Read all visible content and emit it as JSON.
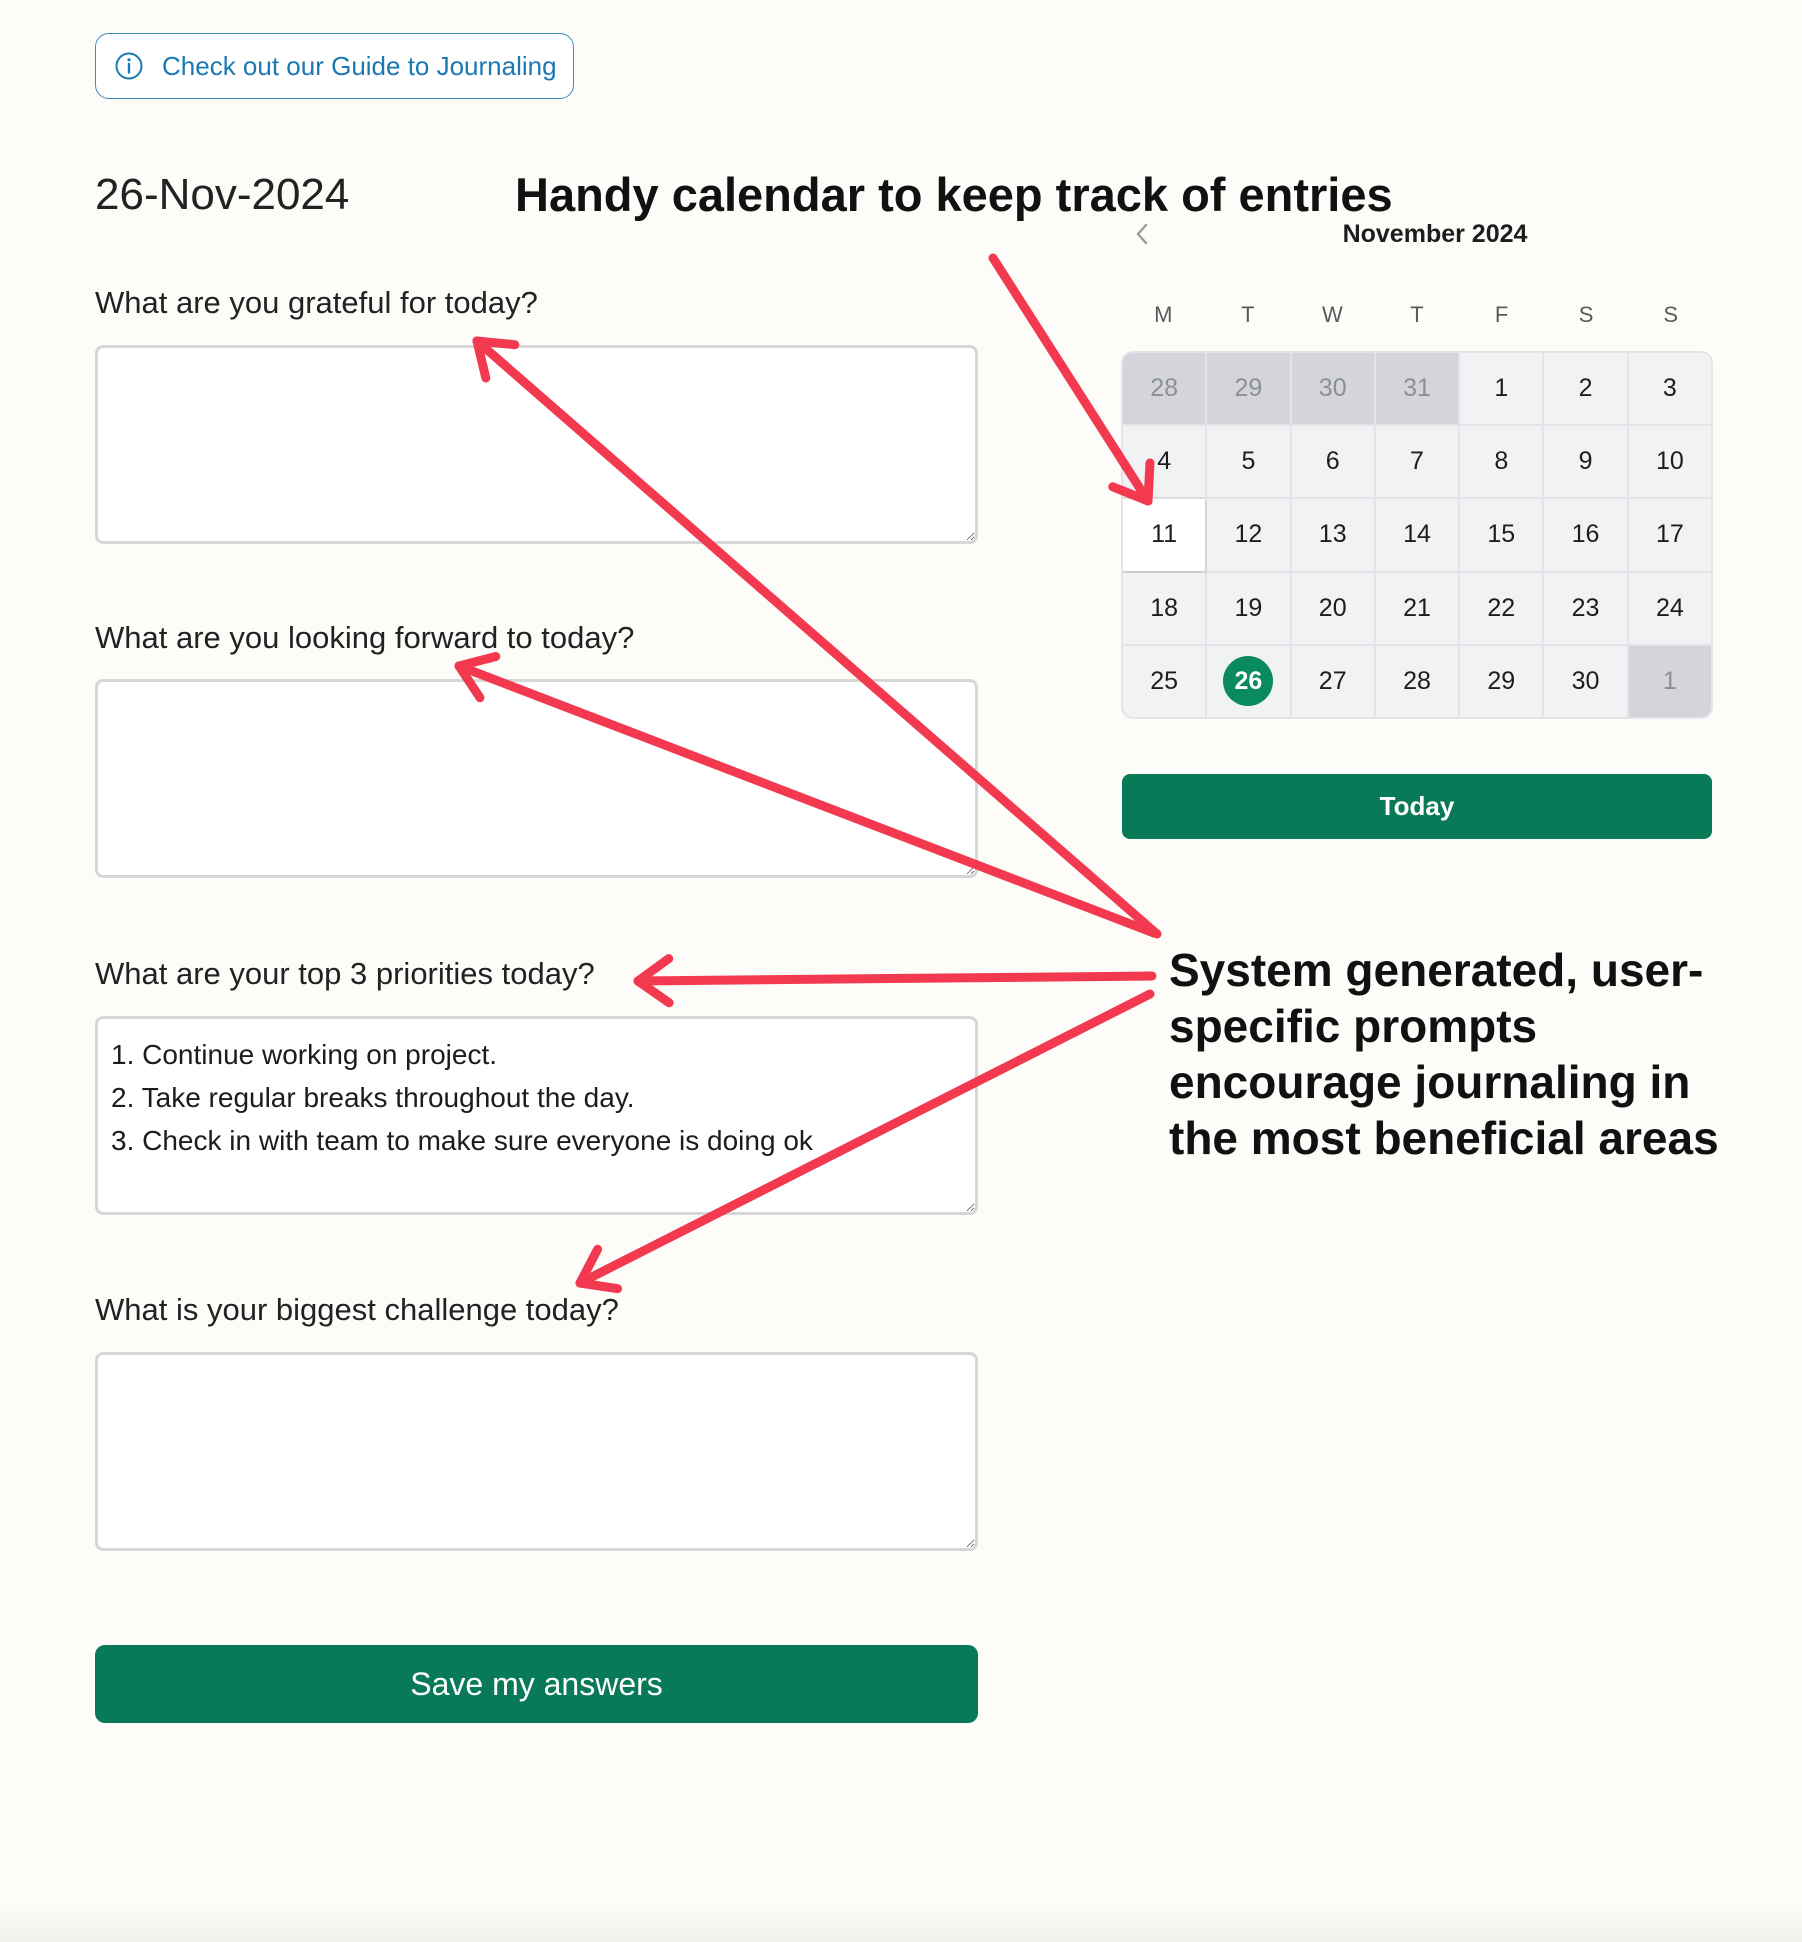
{
  "guide_link": {
    "label": "Check out our Guide to Journaling",
    "icon": "info-icon"
  },
  "journal": {
    "date": "26-Nov-2024",
    "questions": [
      {
        "label": "What are you grateful for today?",
        "answer": ""
      },
      {
        "label": "What are you looking forward to today?",
        "answer": ""
      },
      {
        "label": "What are your top 3 priorities today?",
        "answer": "1. Continue working on project.\n2. Take regular breaks throughout the day.\n3. Check in with team to make sure everyone is doing ok"
      },
      {
        "label": "What is your biggest challenge today?",
        "answer": ""
      }
    ],
    "save_label": "Save my answers"
  },
  "calendar": {
    "title": "November 2024",
    "weekdays": [
      "M",
      "T",
      "W",
      "T",
      "F",
      "S",
      "S"
    ],
    "days": [
      {
        "n": "28",
        "outside": true
      },
      {
        "n": "29",
        "outside": true
      },
      {
        "n": "30",
        "outside": true
      },
      {
        "n": "31",
        "outside": true
      },
      {
        "n": "1"
      },
      {
        "n": "2"
      },
      {
        "n": "3"
      },
      {
        "n": "4"
      },
      {
        "n": "5"
      },
      {
        "n": "6"
      },
      {
        "n": "7"
      },
      {
        "n": "8"
      },
      {
        "n": "9"
      },
      {
        "n": "10"
      },
      {
        "n": "11",
        "hover": true
      },
      {
        "n": "12"
      },
      {
        "n": "13"
      },
      {
        "n": "14"
      },
      {
        "n": "15"
      },
      {
        "n": "16"
      },
      {
        "n": "17"
      },
      {
        "n": "18"
      },
      {
        "n": "19"
      },
      {
        "n": "20"
      },
      {
        "n": "21"
      },
      {
        "n": "22"
      },
      {
        "n": "23"
      },
      {
        "n": "24"
      },
      {
        "n": "25"
      },
      {
        "n": "26",
        "selected": true
      },
      {
        "n": "27"
      },
      {
        "n": "28"
      },
      {
        "n": "29"
      },
      {
        "n": "30"
      },
      {
        "n": "1",
        "outside": true
      }
    ],
    "today_label": "Today",
    "accent_color": "#087a58"
  },
  "annotations": {
    "calendar_note": "Handy calendar to keep track of entries",
    "prompts_note": [
      "System generated, user-",
      "specific prompts",
      "encourage journaling in",
      "the most beneficial areas"
    ],
    "arrow_color": "#f2394f"
  }
}
